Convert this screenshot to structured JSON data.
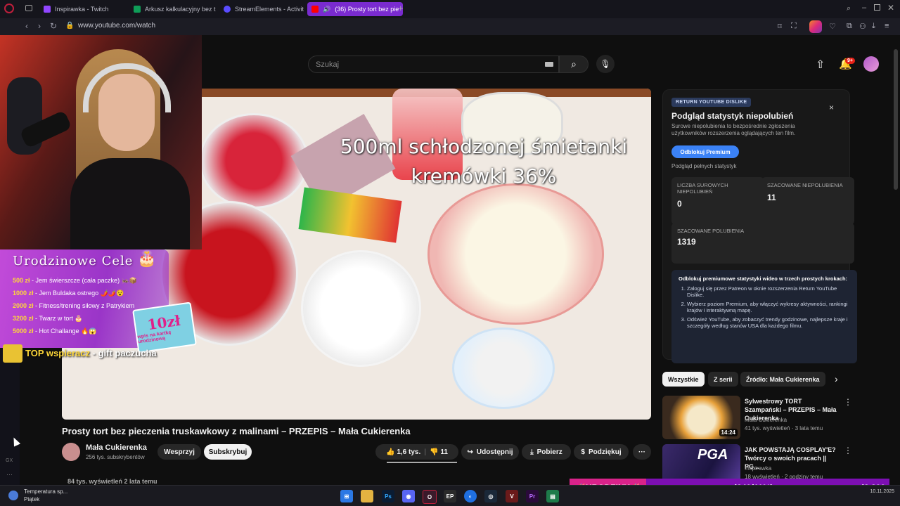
{
  "browser": {
    "tabs": [
      {
        "label": "Inspirawka - Twitch",
        "color": "#9146ff"
      },
      {
        "label": "Arkusz kalkulacyjny bez t",
        "color": "#0f9d58"
      },
      {
        "label": "StreamElements - Activit",
        "color": "#5a4cff"
      },
      {
        "label": "(36) Prosty tort bez pie",
        "color": "#ff0000"
      }
    ],
    "new_tab": "+",
    "url": "www.youtube.com/watch"
  },
  "youtube": {
    "search_placeholder": "Szukaj",
    "notifications_badge": "9+",
    "video": {
      "overlay_line1": "500ml schłodzonej śmietanki",
      "overlay_line2": "kremówki 36%",
      "title": "Prosty tort bez pieczenia truskawkowy z malinami – PRZEPIS – Mała Cukierenka",
      "channel": "Mała Cukierenka",
      "subscribers": "256 tys. subskrybentów",
      "support_label": "Wesprzyj",
      "subscribe_label": "Subskrybuj",
      "likes": "1,6 tys.",
      "dislikes": "11",
      "share_label": "Udostępnij",
      "download_label": "Pobierz",
      "thanks_label": "Podziękuj",
      "views_line": "84 tys. wyświetleń  2 lata temu"
    },
    "ryd": {
      "badge": "RETURN YOUTUBE DISLIKE",
      "title": "Podgląd statystyk niepolubień",
      "description": "Surowe niepolubienia to bezpośrednie zgłoszenia użytkowników rozszerzenia oglądających ten film.",
      "unlock_button": "Odblokuj Premium",
      "full_stats": "Podgląd pełnych statystyk",
      "raw_dislikes_label": "LICZBA SUROWYCH NIEPOLUBIEŃ",
      "raw_dislikes_value": "0",
      "est_dislikes_label": "SZACOWANE NIEPOLUBIENIA",
      "est_dislikes_value": "11",
      "est_likes_label": "SZACOWANE POLUBIENIA",
      "est_likes_value": "1319",
      "steps_title": "Odblokuj premiumowe statystyki wideo w trzech prostych krokach:",
      "steps": [
        "Zaloguj się przez Patreon w oknie rozszerzenia Return YouTube Dislike.",
        "Wybierz poziom Premium, aby włączyć wykresy aktywności, rankingi krajów i interaktywną mapę.",
        "Odśwież YouTube, aby zobaczyć trendy godzinowe, najlepsze kraje i szczegóły według stanów USA dla każdego filmu."
      ],
      "close": "×"
    },
    "chips": [
      "Wszystkie",
      "Z serii",
      "Źródło: Mała Cukierenka"
    ],
    "recommendations": [
      {
        "title": "Sylwestrowy TORT Szampański – PRZEPIS – Mała Cukierenka",
        "channel": "Mała Cukierenka",
        "meta": "41 tys. wyświetleń · 3 lata temu",
        "duration": "14:24"
      },
      {
        "title": "JAK POWSTAJĄ COSPLAY'E? Twórcy o swoich pracach || PG...",
        "channel": "Inspirawka",
        "meta": "18 wyświetleń · 2 godziny temu",
        "thumb_text": "PGA"
      }
    ]
  },
  "stream_overlay": {
    "goals_title": "Urodzinowe Cele",
    "goals": [
      {
        "amount": "500 zł",
        "text": " - Jem świerszcze (cała paczke) 🦗📦"
      },
      {
        "amount": "1000 zł",
        "text": " - Jem Buldaka ostrego 🌶️🌶️😵"
      },
      {
        "amount": "2000 zł",
        "text": " - Fitness/trening siłowy z Patrykiem"
      },
      {
        "amount": "3200 zł",
        "text": " - Twarz w tort 🎂"
      },
      {
        "amount": "5000 zł",
        "text": " - Hot Challange 🔥😱"
      }
    ],
    "card_big": "10zł",
    "card_small": "wpis na kartkę urodzinową",
    "top_supporter": "TOP wspieracz",
    "top_supporter_suffix": " - gift paczucha",
    "birthday_label": "🥳URODZINY🥳",
    "birthday_progress": "zł340(11%)",
    "birthday_goal": "zł3,200",
    "birthday_fraction": 0.11
  },
  "taskbar": {
    "weather_line1": "Temperatura sp...",
    "weather_line2": "Piątek",
    "clock_line": "10.11.2025"
  }
}
